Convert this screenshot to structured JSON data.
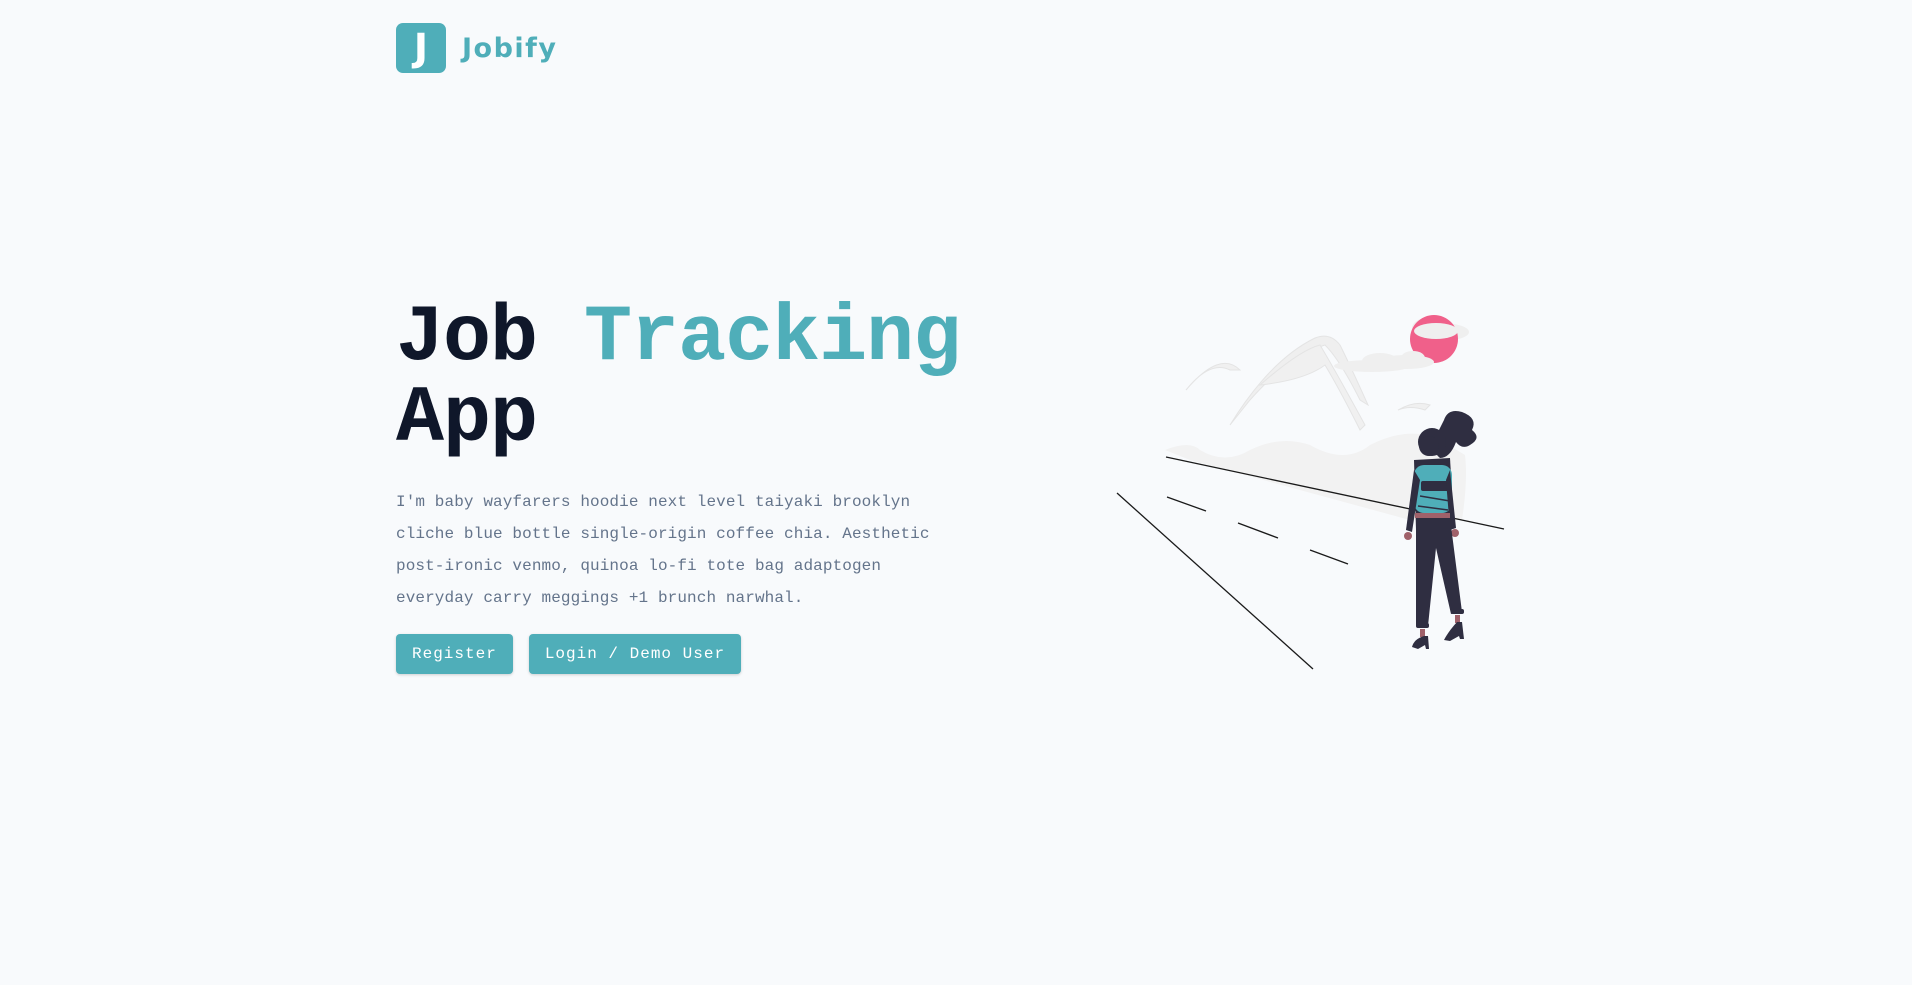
{
  "brand": {
    "logo_letter": "J",
    "name": "Jobify",
    "color": "#4faeb9"
  },
  "hero": {
    "title_part1": "Job",
    "title_accent": "Tracking",
    "title_part2": "App",
    "description": "I'm baby wayfarers hoodie next level taiyaki brooklyn cliche blue bottle single-origin coffee chia. Aesthetic post-ironic venmo, quinoa lo-fi tote bag adaptogen everyday carry meggings +1 brunch narwhal."
  },
  "buttons": {
    "register_label": "Register",
    "login_label": "Login / Demo User"
  },
  "colors": {
    "primary": "#4faeb9",
    "heading": "#0f172a",
    "text_muted": "#64748b",
    "background": "#f8fafc",
    "sun": "#f0608a",
    "figure_dark": "#2f2e41"
  }
}
